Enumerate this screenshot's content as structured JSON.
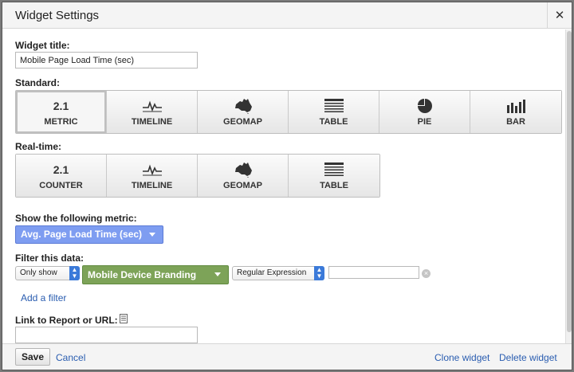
{
  "dialog": {
    "title": "Widget Settings",
    "close_glyph": "✕"
  },
  "widget_title": {
    "label": "Widget title:",
    "value": "Mobile Page Load Time (sec)"
  },
  "standard": {
    "label": "Standard:",
    "buttons": [
      {
        "icon": "2.1",
        "label": "METRIC",
        "active": true
      },
      {
        "icon": "timeline-icon",
        "label": "TIMELINE"
      },
      {
        "icon": "australia-map-icon",
        "label": "GEOMAP"
      },
      {
        "icon": "table-icon",
        "label": "TABLE"
      },
      {
        "icon": "pie-icon",
        "label": "PIE"
      },
      {
        "icon": "bar-chart-icon",
        "label": "BAR"
      }
    ]
  },
  "realtime": {
    "label": "Real-time:",
    "buttons": [
      {
        "icon": "2.1",
        "label": "COUNTER"
      },
      {
        "icon": "timeline-icon",
        "label": "TIMELINE"
      },
      {
        "icon": "australia-map-icon",
        "label": "GEOMAP"
      },
      {
        "icon": "table-icon",
        "label": "TABLE"
      }
    ]
  },
  "metric": {
    "label": "Show the following metric:",
    "selected": "Avg. Page Load Time (sec)"
  },
  "filter": {
    "label": "Filter this data:",
    "mode": "Only show",
    "dimension": "Mobile Device Branding",
    "match_type": "Regular Expression",
    "value": "",
    "add_filter": "Add a filter"
  },
  "link": {
    "label": "Link to Report or URL:",
    "value": ""
  },
  "footer": {
    "save": "Save",
    "cancel": "Cancel",
    "clone": "Clone widget",
    "delete": "Delete widget"
  },
  "colors": {
    "metric_accent": "#7e9df1",
    "dimension_accent": "#7da358",
    "link": "#2a5db0"
  }
}
